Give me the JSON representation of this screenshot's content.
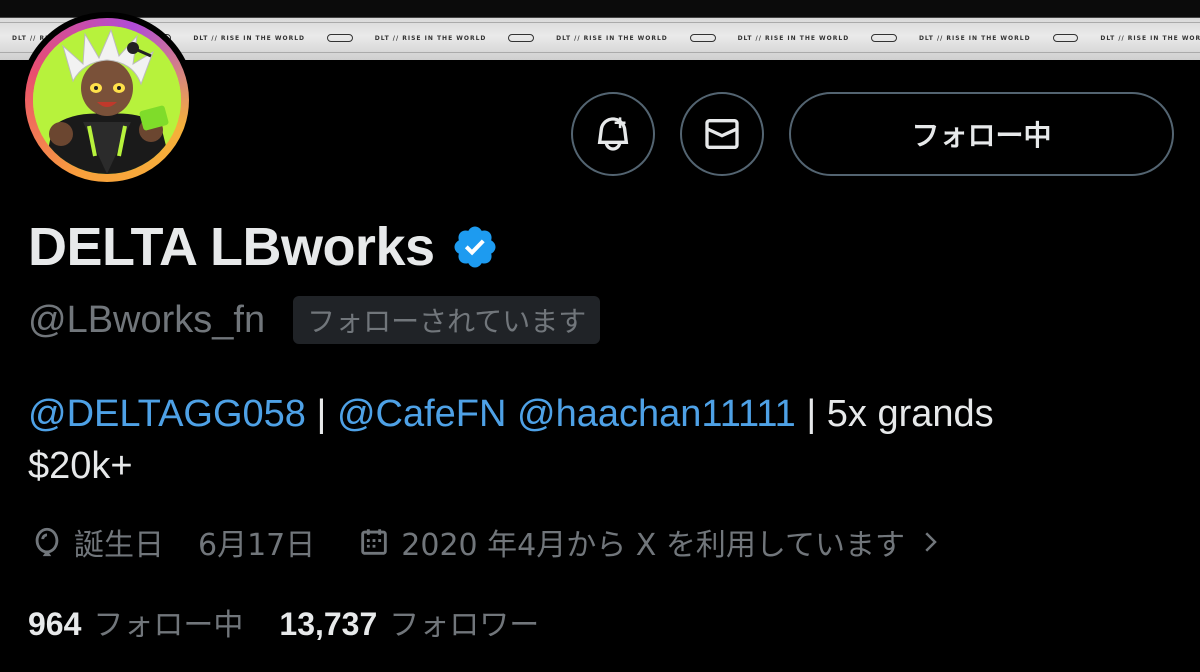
{
  "banner": {
    "strip_text": "DLT // RISE IN THE WORLD"
  },
  "profile": {
    "display_name": "DELTA LBworks",
    "handle": "@LBworks_fn",
    "follows_you_label": "フォローされています",
    "verified": true
  },
  "actions": {
    "notify_icon": "bell-plus-icon",
    "message_icon": "envelope-icon",
    "follow_label": "フォロー中"
  },
  "bio": {
    "mention_1": "@DELTAGG058",
    "sep_1": " | ",
    "mention_2": "@CafeFN",
    "space": " ",
    "mention_3": "@haachan11111",
    "rest_line1": " | 5x grands",
    "line2": "$20k+"
  },
  "meta": {
    "birthday_label": "誕生日",
    "birthday_value": "6月17日",
    "joined": "2020 年4月から X を利用しています"
  },
  "stats": {
    "following_count": "964",
    "following_label": "フォロー中",
    "followers_count": "13,737",
    "followers_label": "フォロワー"
  },
  "colors": {
    "background": "#000000",
    "text_primary": "#e7e9ea",
    "text_secondary": "#71767b",
    "link": "#4ea1e6",
    "verified": "#1d9bf0",
    "border": "#536471"
  }
}
